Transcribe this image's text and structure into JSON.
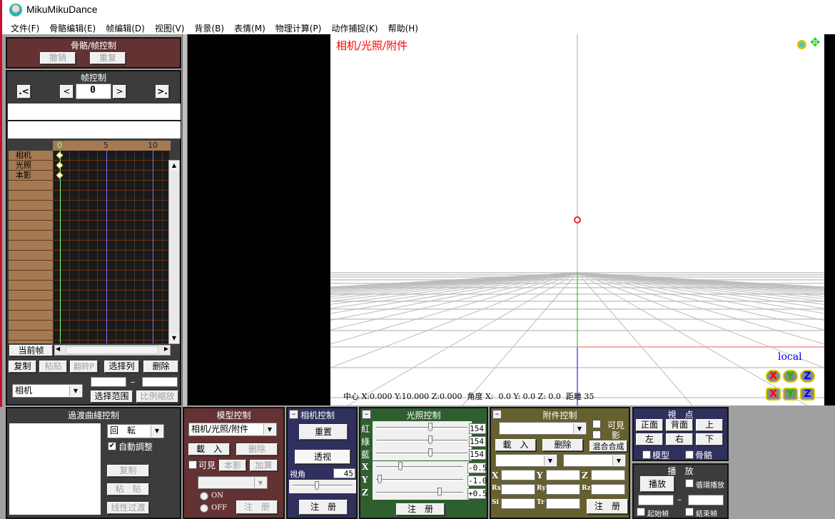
{
  "window": {
    "title": "MikuMikuDance"
  },
  "menu": [
    "文件(F)",
    "骨骼编辑(E)",
    "帧编辑(D)",
    "视图(V)",
    "背景(B)",
    "表情(M)",
    "物理计算(P)",
    "动作捕捉(K)",
    "帮助(H)"
  ],
  "bone_frame": {
    "title": "骨骼/帧控制",
    "undo": "撤销",
    "redo": "重复"
  },
  "frame_control": {
    "title": "帧控制",
    "first": ".<",
    "prev": "<",
    "frame": "0",
    "next": ">",
    "last": ">.",
    "ruler": [
      "0",
      "5",
      "10"
    ],
    "tracks": [
      "相机",
      "光照",
      "本影"
    ],
    "current_frame": "当前帧",
    "copy": "复制",
    "paste": "粘贴",
    "flip": "翻转P",
    "select_col": "选择列",
    "delete": "删除",
    "target": "相机",
    "range_from": "",
    "range_dash": "–",
    "range_to": "",
    "select_range": "选择范围",
    "scale": "比例缩放"
  },
  "viewport": {
    "mode_label": "相机/光照/附件",
    "local": "local",
    "status": "中心 X:0.000 Y:10.000 Z:0.000  角度 X:  0.0 Y: 0.0 Z: 0.0  距離 35",
    "colors": {
      "x": "#ff0000",
      "y": "#00c000",
      "z": "#0000ff"
    }
  },
  "curve": {
    "title": "過渡曲綫控制",
    "type": "回　転",
    "auto": "自動調整",
    "copy": "复制",
    "paste": "粘　贴",
    "linear": "线性过渡"
  },
  "model": {
    "title": "模型控制",
    "selected": "相机/光照/附件",
    "load": "載　入",
    "delete": "删除",
    "visible": "可見",
    "shadow": "本影",
    "add": "加算",
    "on": "ON",
    "off": "OFF",
    "register": "注　册"
  },
  "camera": {
    "title": "相机控制",
    "reset": "重置",
    "perspective": "透视",
    "fov_label": "視角",
    "fov": "45",
    "fov_fraction": 0.4,
    "register": "注　册"
  },
  "light": {
    "title": "光照控制",
    "rgb_labels": [
      "紅",
      "綠",
      "藍"
    ],
    "rgb": [
      "154",
      "154",
      "154"
    ],
    "rgb_fraction": [
      0.6,
      0.6,
      0.6
    ],
    "xyz_labels": [
      "X",
      "Y",
      "Z"
    ],
    "xyz": [
      "-0.5",
      "-1.0",
      "+0.5"
    ],
    "xyz_fraction": [
      0.27,
      0.02,
      0.74
    ],
    "register": "注　册"
  },
  "accessory": {
    "title": "附件控制",
    "visible": "可見",
    "shadow": "影",
    "load": "載　入",
    "delete": "删除",
    "blend": "混合合成",
    "fields": [
      "X",
      "Y",
      "Z",
      "Rx",
      "Ry",
      "Rz",
      "Si",
      "Tr"
    ],
    "register": "注　册"
  },
  "viewpoint": {
    "title": "視　点",
    "buttons": [
      "正面",
      "背面",
      "上",
      "左",
      "右",
      "下"
    ],
    "model": "模型",
    "bone": "骨骼"
  },
  "play": {
    "title": "播　放",
    "play": "播放",
    "loop": "循環播放",
    "dash": "–",
    "start": "起始幀",
    "end": "結束幀"
  }
}
